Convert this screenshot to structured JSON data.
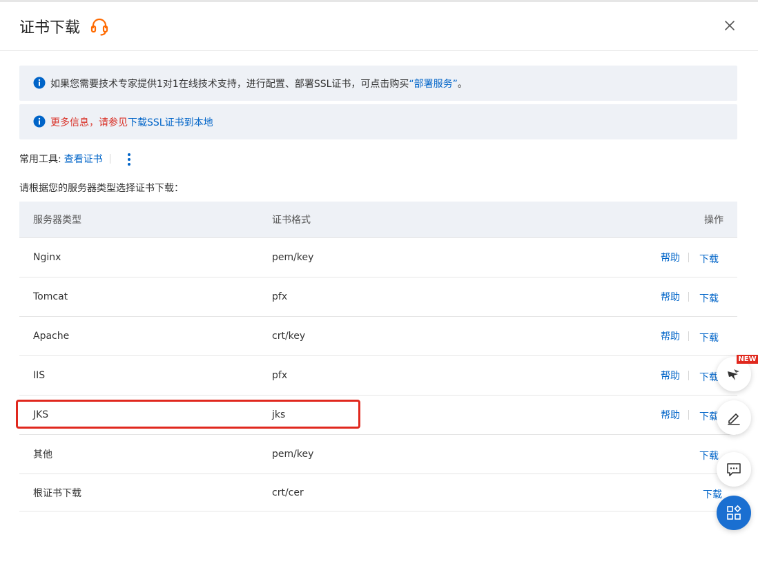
{
  "header": {
    "title": "证书下载"
  },
  "alerts": {
    "deploy": {
      "text_before": "如果您需要技术专家提供1对1在线技术支持，进行配置、部署SSL证书，可点击购买",
      "link": "“部署服务”",
      "text_after": "。"
    },
    "more_info": {
      "text_red": "更多信息，请参见",
      "link": "下载SSL证书到本地"
    }
  },
  "tools": {
    "label": "常用工具:",
    "view_cert": "查看证书"
  },
  "hint": "请根据您的服务器类型选择证书下载：",
  "table": {
    "headers": {
      "server_type": "服务器类型",
      "cert_format": "证书格式",
      "actions": "操作"
    },
    "rows": [
      {
        "server": "Nginx",
        "format": "pem/key",
        "help": "帮助",
        "download": "下载"
      },
      {
        "server": "Tomcat",
        "format": "pfx",
        "help": "帮助",
        "download": "下载"
      },
      {
        "server": "Apache",
        "format": "crt/key",
        "help": "帮助",
        "download": "下载"
      },
      {
        "server": "IIS",
        "format": "pfx",
        "help": "帮助",
        "download": "下载"
      },
      {
        "server": "JKS",
        "format": "jks",
        "help": "帮助",
        "download": "下载"
      },
      {
        "server": "其他",
        "format": "pem/key",
        "download": "下载"
      },
      {
        "server": "根证书下载",
        "format": "crt/cer",
        "download": "下载"
      }
    ]
  },
  "floating": {
    "new_badge": "NEW"
  },
  "colors": {
    "link": "#0064c8",
    "alert_bg": "#eef1f6",
    "highlight": "#e0281e",
    "support_icon": "#ff6a00",
    "fab_primary": "#1a6fd1"
  }
}
